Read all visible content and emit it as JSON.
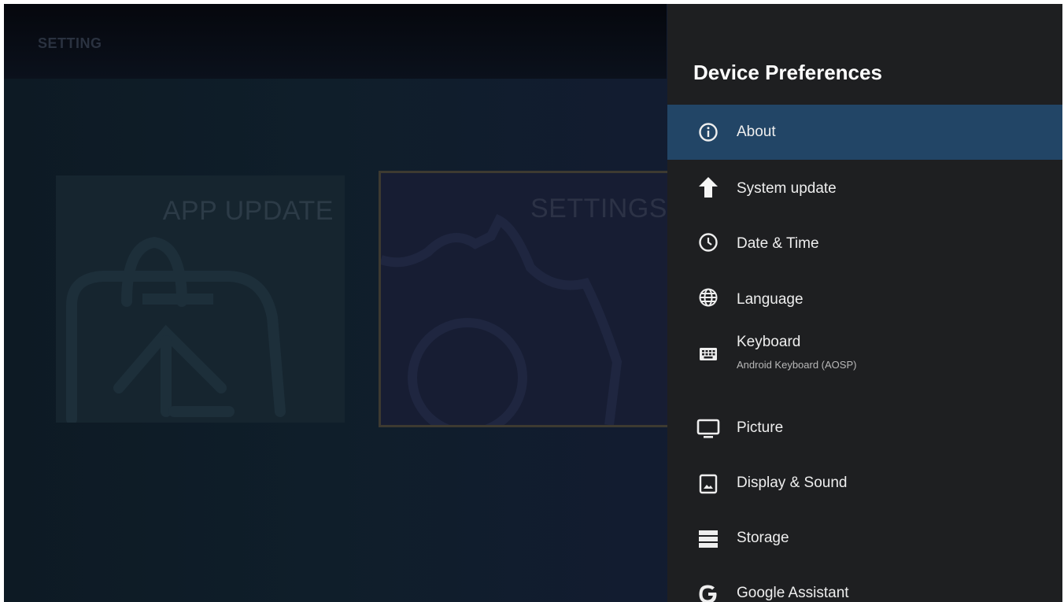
{
  "app": {
    "title": "SETTING"
  },
  "tiles": [
    {
      "label": "APP UPDATE",
      "icon": "app-update-icon"
    },
    {
      "label": "SETTINGS",
      "icon": "gear-icon"
    }
  ],
  "panel": {
    "title": "Device Preferences",
    "selected_index": 0,
    "selected_color": "#224566",
    "items": [
      {
        "label": "About",
        "icon": "info-icon"
      },
      {
        "label": "System update",
        "icon": "arrow-up-icon"
      },
      {
        "label": "Date & Time",
        "icon": "clock-icon"
      },
      {
        "label": "Language",
        "icon": "globe-icon"
      },
      {
        "label": "Keyboard",
        "subtitle": "Android Keyboard (AOSP)",
        "icon": "keyboard-icon"
      },
      {
        "label": "Picture",
        "icon": "monitor-icon"
      },
      {
        "label": "Display & Sound",
        "icon": "display-sound-icon"
      },
      {
        "label": "Storage",
        "icon": "storage-icon"
      },
      {
        "label": "Google Assistant",
        "icon": "google-g-icon"
      }
    ]
  }
}
